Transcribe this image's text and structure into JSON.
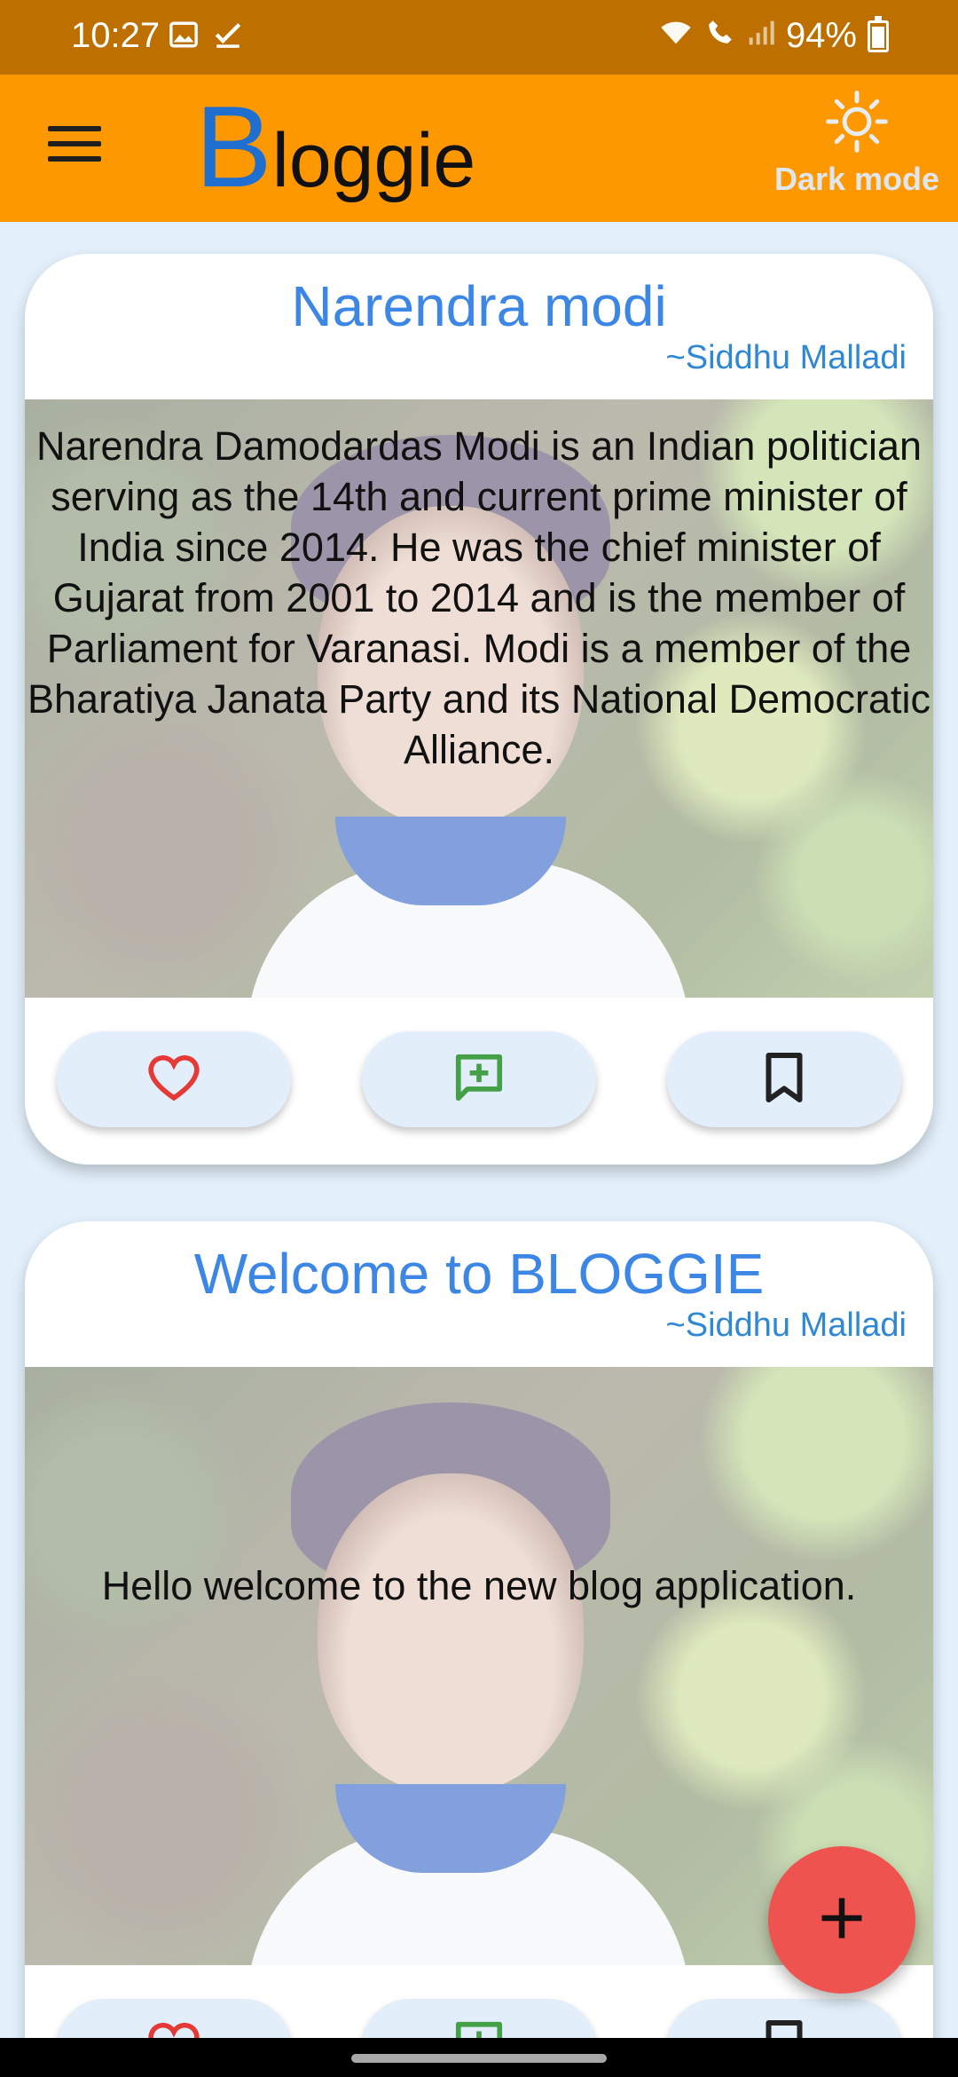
{
  "status_bar": {
    "time": "10:27",
    "battery": "94%",
    "icons": [
      "gallery-icon",
      "check-icon",
      "wifi-icon",
      "wifi-call-icon",
      "signal-icon",
      "battery-icon"
    ]
  },
  "app_bar": {
    "brand_first": "B",
    "brand_rest": "loggie",
    "dark_mode_label": "Dark mode",
    "colors": {
      "bar": "#fe9800",
      "brand_b": "#1f6fd1"
    }
  },
  "posts": [
    {
      "title": "Narendra modi",
      "author": "~Siddhu Malladi",
      "body": "Narendra Damodardas Modi is an Indian politician serving as the 14th and current prime minister of India since 2014. He was the chief minister of Gujarat from 2001 to 2014 and is the member of Parliament for Varanasi. Modi is a member of the Bharatiya Janata Party and its National Democratic Alliance."
    },
    {
      "title": "Welcome to BLOGGIE",
      "author": "~Siddhu Malladi",
      "body": "Hello welcome to the new blog application."
    }
  ],
  "actions": [
    "heart-icon",
    "add-comment-icon",
    "bookmark-icon"
  ],
  "colors": {
    "background": "#e3f0fb",
    "title": "#3c86e6",
    "like": "#e53935",
    "comment": "#43a047",
    "fab": "#ef5350"
  }
}
